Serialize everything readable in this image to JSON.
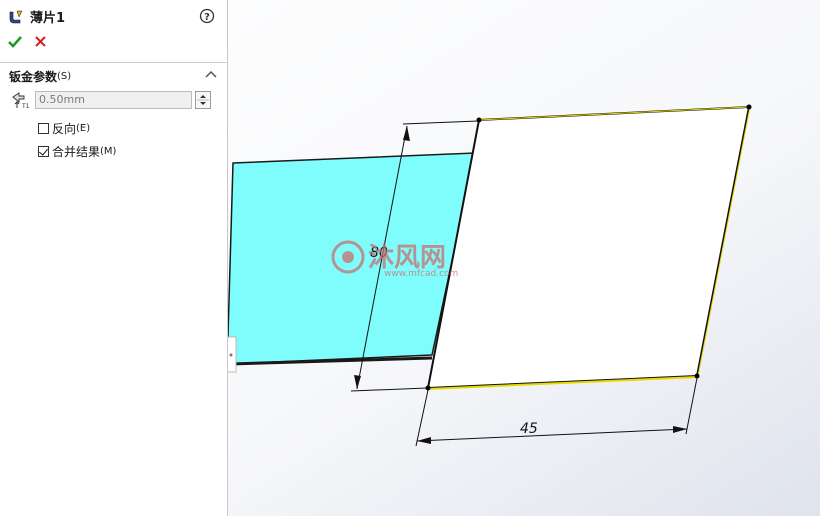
{
  "panel": {
    "title": "薄片1",
    "section_title": "钣金参数",
    "section_shortcut": "(S)",
    "thickness_value": "0.50mm",
    "reverse_label": "反向",
    "reverse_shortcut": "(E)",
    "merge_label": "合并结果",
    "merge_shortcut": "(M)",
    "reverse_checked": false,
    "merge_checked": true
  },
  "dimensions": {
    "vertical": "80",
    "horizontal": "45"
  },
  "watermark": {
    "cn": "沐风网",
    "url": "www.mfcad.com"
  },
  "colors": {
    "face": "#7ffcfc",
    "edge_highlight": "#e6d800",
    "accent_green": "#1a9c1a",
    "accent_red": "#d42020",
    "watermark": "#c87070"
  },
  "icons": {
    "feature": "sheet-metal-icon",
    "help": "help-icon",
    "ok": "checkmark-icon",
    "cancel": "close-icon",
    "thickness": "thickness-icon"
  }
}
